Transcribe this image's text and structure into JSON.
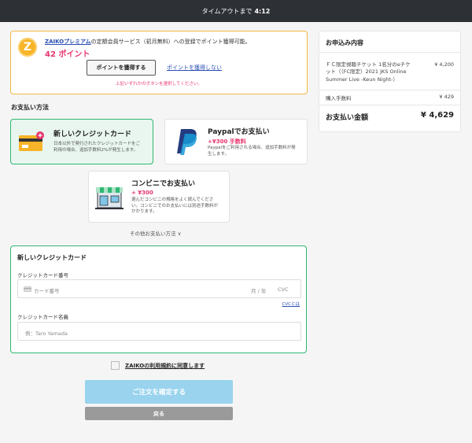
{
  "topbar": {
    "label": "タイムアウトまで",
    "time": "4:12"
  },
  "premium": {
    "logo": "Z",
    "brand": "ZAIKOプレミアム",
    "text": "の定額会員サービス（初月無料）への登録でポイント獲得可能。",
    "points": "42 ポイント",
    "use_button": "ポイントを獲得する",
    "skip_link": "ポイントを獲得しない",
    "warning": "上記いずれかのボタンを選択してください。"
  },
  "payment": {
    "section_title": "お支払い方法",
    "methods": [
      {
        "title": "新しいクレジットカード",
        "desc1": "日本以外で発行されたクレジットカードをご",
        "desc2": "利用の場合、追加手数料2%が発生します。",
        "icon": "credit-card-icon",
        "selected": true
      },
      {
        "title": "Paypalでお支払い",
        "fee": "+¥300 手数料",
        "desc1": "Paypalをご利用される場合、追加手数料が発",
        "desc2": "生します。",
        "icon": "paypal-icon"
      },
      {
        "title": "コンビニでお支払い",
        "fee": "+ ¥300",
        "desc1": "選んだコンビニの規格をよく読んでくださ",
        "desc2": "い。コンビニでのお支払いには別途手数料が",
        "desc3": "かかります。",
        "icon": "convenience-store-icon"
      }
    ],
    "other_link": "その他お支払い方法 ∨"
  },
  "card_form": {
    "title": "新しいクレジットカード",
    "number_label": "クレジットカード番号",
    "number_placeholder": "カード番号",
    "expiry_placeholder": "月 / 年",
    "cvc_placeholder": "CVC",
    "cvc_help": "CVCとは",
    "name_label": "クレジットカード名義",
    "name_placeholder": "例：Taro Yamada"
  },
  "agree": {
    "label": "ZAIKOの利用規約に同意します"
  },
  "buttons": {
    "confirm": "ご注文を確定する",
    "back": "戻る"
  },
  "summary": {
    "title": "お申込み内容",
    "item_line1": "ＦＣ限定視聴チケット 1名分のeチケ",
    "item_line2": "ット（（FC限定）2021 JKS Online",
    "item_line3": "Summer Live -Keun Night-）",
    "item_price": "¥ 4,200",
    "fee_label": "購入手数料",
    "fee_price": "¥ 429",
    "total_label": "お支払い金額",
    "total_price": "¥ 4,629"
  }
}
